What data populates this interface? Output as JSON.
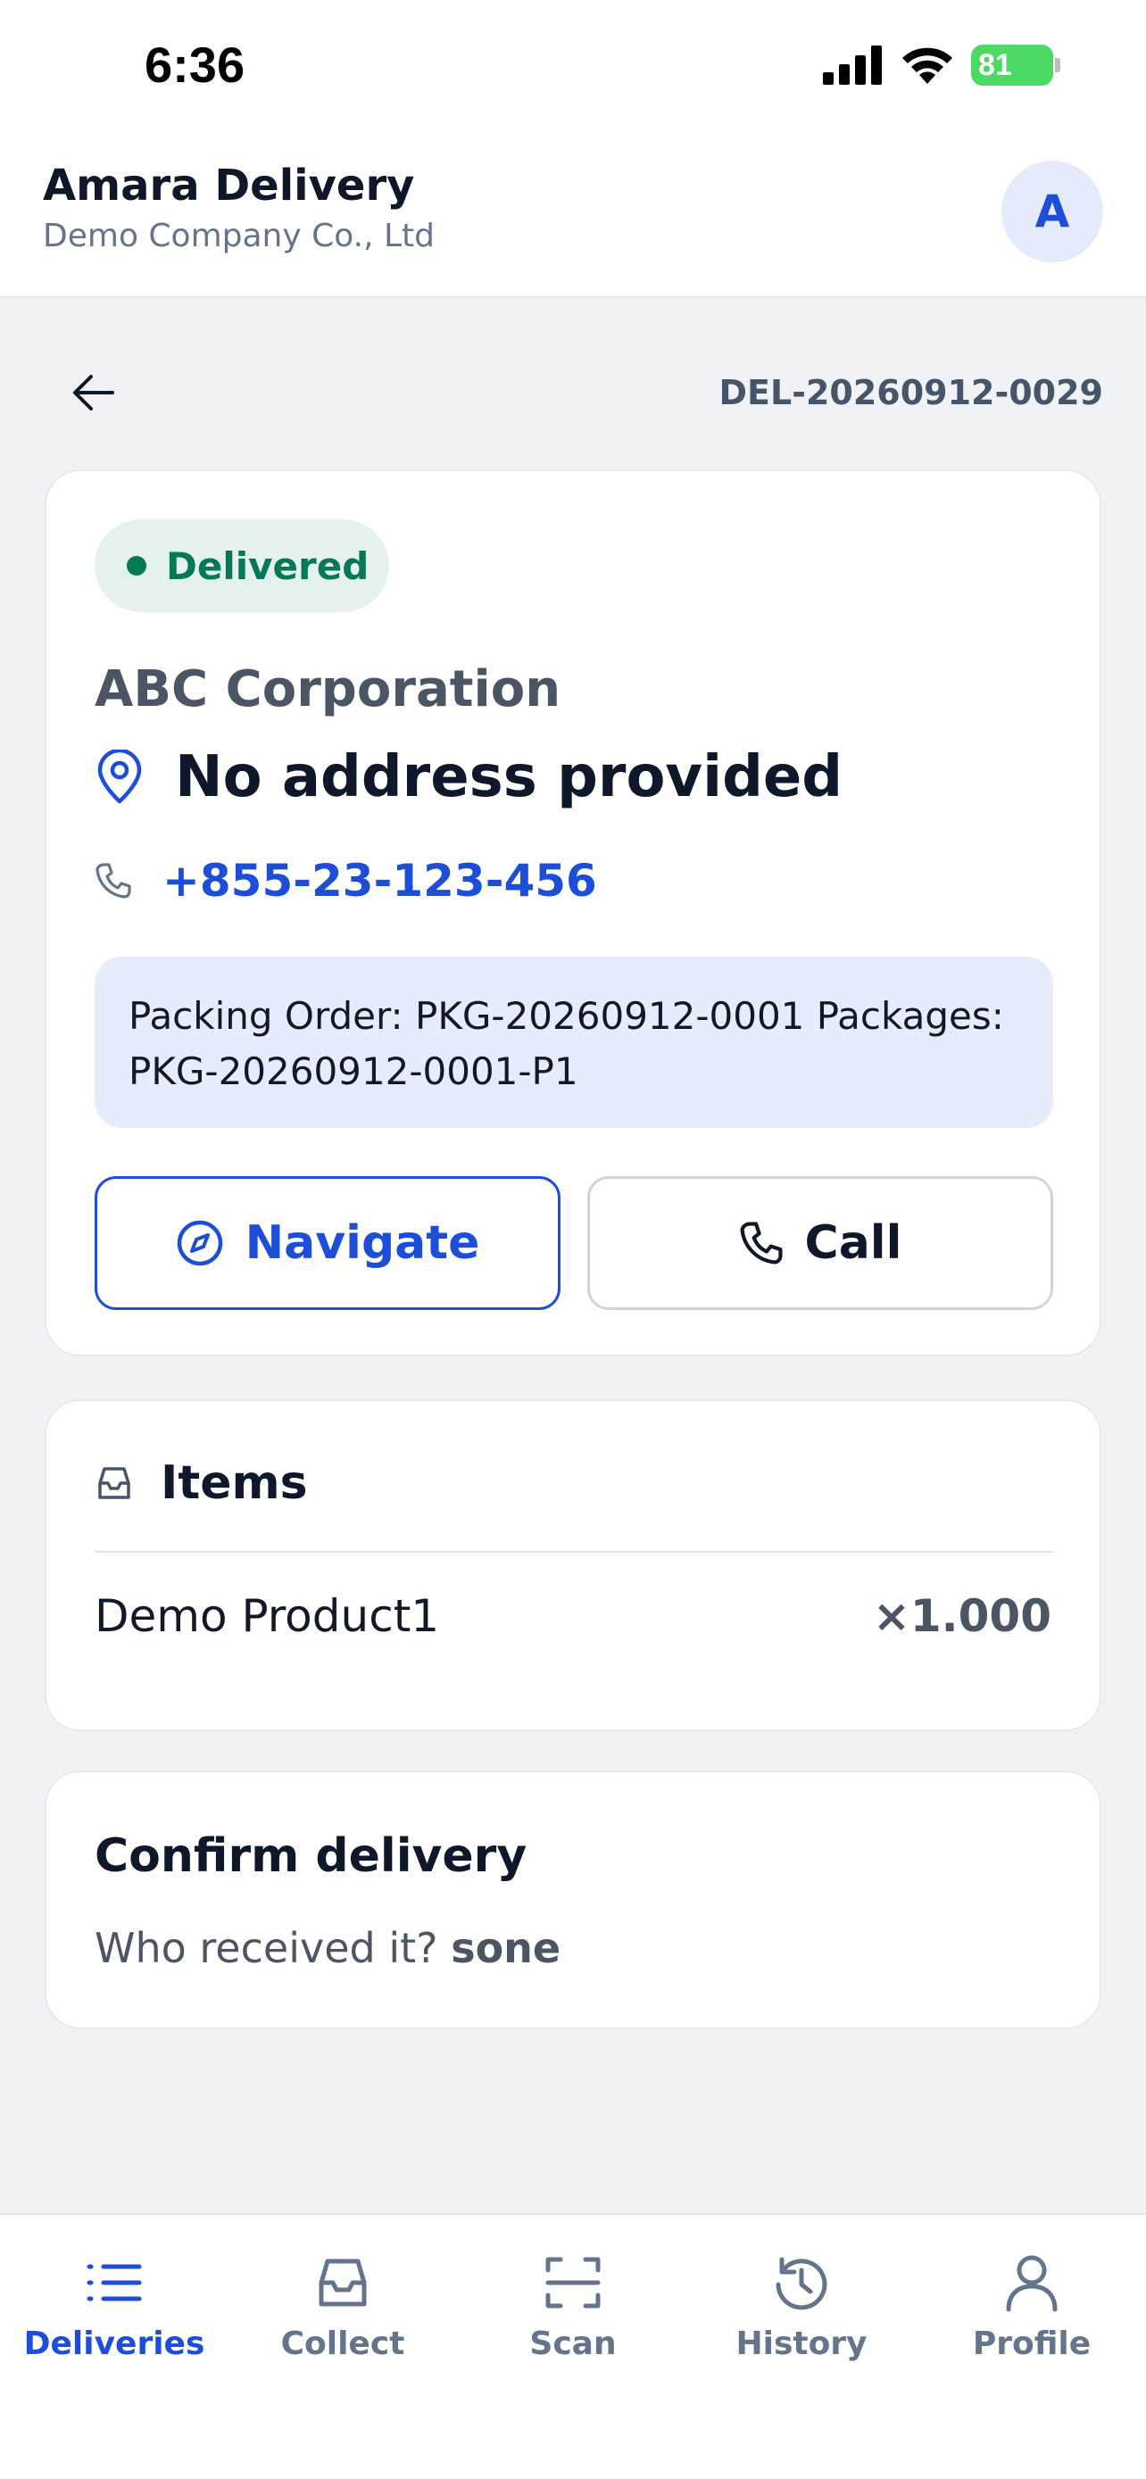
{
  "status_bar": {
    "time": "6:36",
    "battery": "81"
  },
  "header": {
    "title": "Amara Delivery",
    "subtitle": "Demo Company Co., Ltd",
    "avatar_initial": "A"
  },
  "nav": {
    "reference": "DEL-20260912-0029"
  },
  "delivery": {
    "status": "Delivered",
    "customer": "ABC Corporation",
    "address": "No address provided",
    "phone": "+855-23-123-456",
    "packing_info": "Packing Order: PKG-20260912-0001 Packages: PKG-20260912-0001-P1",
    "navigate_label": "Navigate",
    "call_label": "Call"
  },
  "items": {
    "title": "Items",
    "list": [
      {
        "name": "Demo Product1",
        "qty": "×1.000"
      }
    ]
  },
  "confirm": {
    "title": "Confirm delivery",
    "question": "Who received it?",
    "receiver": "sone"
  },
  "tabs": [
    {
      "label": "Deliveries",
      "icon": "list-icon",
      "active": true
    },
    {
      "label": "Collect",
      "icon": "inbox-icon",
      "active": false
    },
    {
      "label": "Scan",
      "icon": "scan-icon",
      "active": false
    },
    {
      "label": "History",
      "icon": "history-icon",
      "active": false
    },
    {
      "label": "Profile",
      "icon": "user-icon",
      "active": false
    }
  ],
  "colors": {
    "accent": "#1d4ed8",
    "success": "#047857",
    "background": "#f0f2f6"
  }
}
